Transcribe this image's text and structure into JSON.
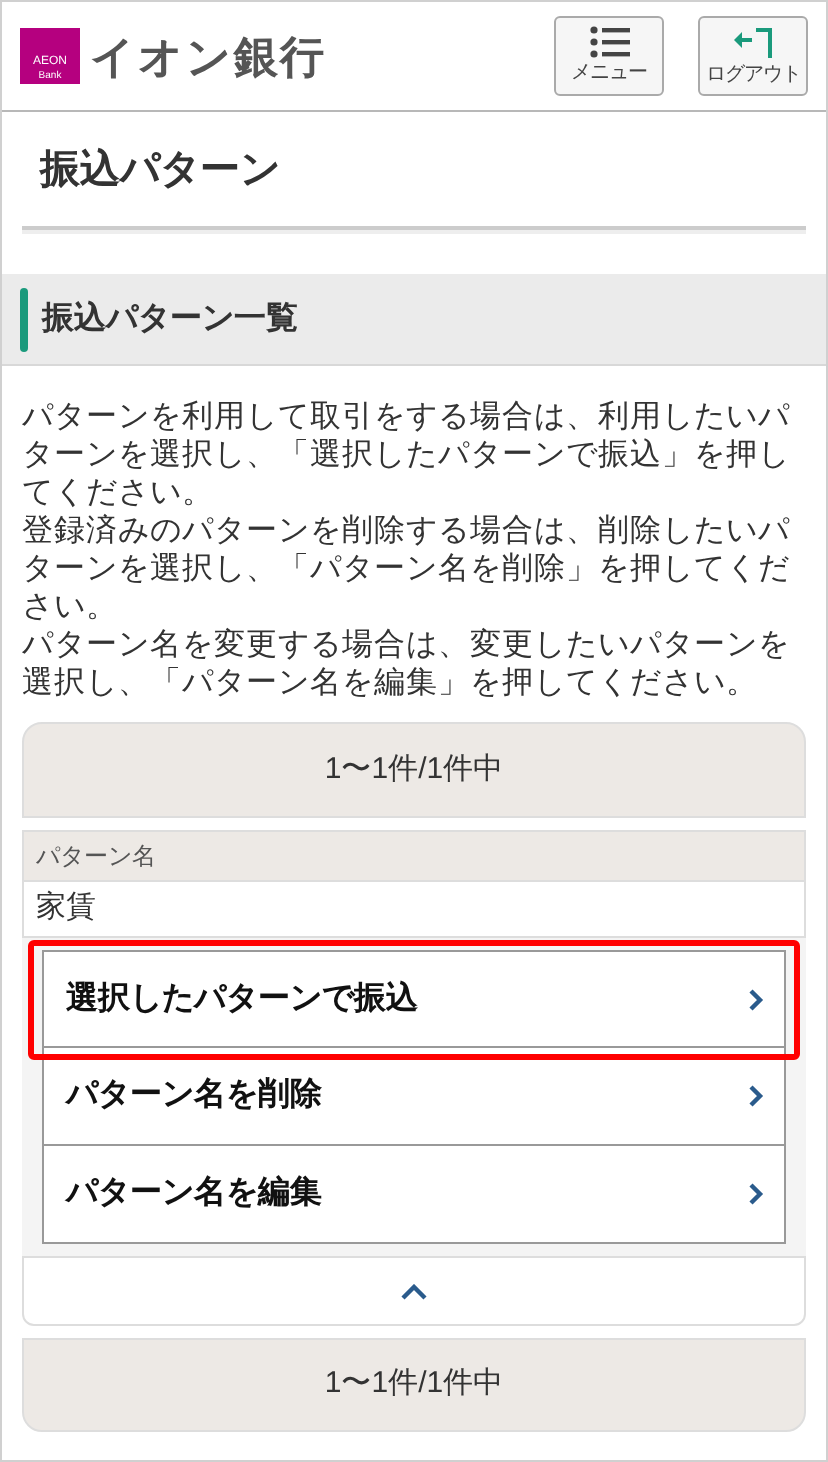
{
  "header": {
    "logo": {
      "mark_top": "AEON",
      "mark_bottom": "Bank",
      "name": "イオン銀行"
    },
    "buttons": [
      {
        "kind": "menu",
        "label": "メニュー"
      },
      {
        "kind": "logout",
        "label": "ログアウト"
      }
    ]
  },
  "page_title": "振込パターン",
  "section_title": "振込パターン一覧",
  "instructions": [
    "パターンを利用して取引をする場合は、利用したいパターンを選択し、「選択したパターンで振込」を押してください。",
    "登録済みのパターンを削除する場合は、削除したいパターンを選択し、「パターン名を削除」を押してください。",
    "パターン名を変更する場合は、変更したいパターンを選択し、「パターン名を編集」を押してください。"
  ],
  "pager_top": "1〜1件/1件中",
  "table": {
    "columns": [
      "パターン名"
    ],
    "rows": [
      [
        "家賃"
      ]
    ]
  },
  "actions": [
    {
      "label": "選択したパターンで振込",
      "highlighted": true
    },
    {
      "label": "パターン名を削除",
      "highlighted": false
    },
    {
      "label": "パターン名を編集",
      "highlighted": false
    }
  ],
  "pager_bottom": "1〜1件/1件中"
}
